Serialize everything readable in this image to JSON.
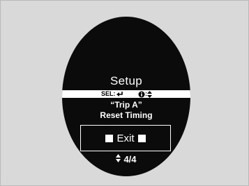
{
  "display": {
    "title": "Setup",
    "select_bar": {
      "sel_label": "SEL:",
      "enter_icon": "enter-arrow-icon",
      "info_icon": "info-icon",
      "info_separator": ":",
      "scroll_icon": "up-down-arrows-icon"
    },
    "item_name": "“Trip A”",
    "item_action": "Reset Timing",
    "exit_button": {
      "label": "Exit",
      "left_icon": "square-icon",
      "right_icon": "square-icon"
    },
    "pagination": {
      "icon": "up-down-triangles-icon",
      "text": "4/4"
    }
  },
  "colors": {
    "background": "#d9d9d9",
    "screen": "#0b0b0b",
    "foreground": "#ffffff",
    "highlight_bar": "#ffffff"
  }
}
